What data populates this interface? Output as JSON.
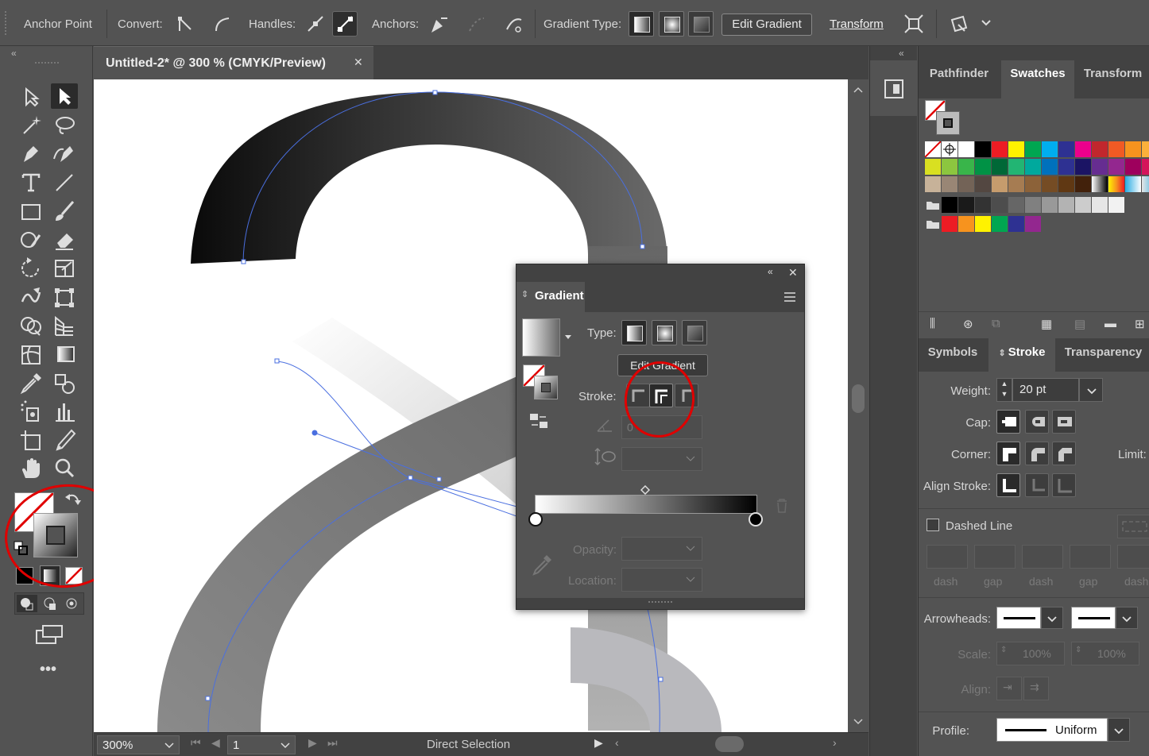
{
  "control_bar": {
    "anchor_point_label": "Anchor Point",
    "convert_label": "Convert:",
    "handles_label": "Handles:",
    "anchors_label": "Anchors:",
    "gradient_type_label": "Gradient Type:",
    "edit_gradient_label": "Edit Gradient",
    "transform_label": "Transform"
  },
  "document": {
    "tab_title": "Untitled-2* @ 300 % (CMYK/Preview)",
    "close_glyph": "✕"
  },
  "status_bar": {
    "zoom": "300%",
    "artboard_number": "1",
    "current_tool": "Direct Selection"
  },
  "gradient_panel": {
    "title": "Gradient",
    "type_label": "Type:",
    "edit_gradient_tooltip": "Edit Gradient",
    "stroke_label": "Stroke:",
    "angle_value": "0",
    "opacity_label": "Opacity:",
    "location_label": "Location:"
  },
  "right_panel": {
    "top_tabs": [
      "Pathfinder",
      "Swatches",
      "Transform"
    ],
    "active_top_tab": "Swatches",
    "bottom_tabs": [
      "Symbols",
      "Stroke",
      "Transparency"
    ],
    "active_bottom_tab": "Stroke",
    "stroke": {
      "weight_label": "Weight:",
      "weight_value": "20 pt",
      "cap_label": "Cap:",
      "corner_label": "Corner:",
      "limit_label": "Limit:",
      "align_stroke_label": "Align Stroke:",
      "dashed_line_label": "Dashed Line",
      "dash_labels": [
        "dash",
        "gap",
        "dash",
        "gap",
        "dash"
      ],
      "arrowheads_label": "Arrowheads:",
      "scale_label": "Scale:",
      "scale_values": [
        "100%",
        "100%"
      ],
      "align_label": "Align:",
      "profile_label": "Profile:",
      "profile_value": "Uniform"
    },
    "swatch_rows": [
      [
        "none",
        "reg",
        "#ffffff",
        "#000000",
        "#ed1c24",
        "#fff200",
        "#00a651",
        "#00aeef",
        "#2e3192",
        "#ec008c",
        "#c1272d",
        "#f15a24",
        "#f7931e",
        "#fbb03b"
      ],
      [
        "#d9e021",
        "#8cc63f",
        "#39b54a",
        "#009245",
        "#006837",
        "#22b573",
        "#00a99d",
        "#0071bc",
        "#2e3192",
        "#1b1464",
        "#662d91",
        "#93278f",
        "#9e005d",
        "#d4145a"
      ],
      [
        "#c7b299",
        "#998675",
        "#736357",
        "#534741",
        "#c69c6d",
        "#a67c52",
        "#8c6239",
        "#754c24",
        "#603813",
        "#42210b",
        "grad-gray",
        "grad-orange",
        "grad-blue",
        "grad-cyan"
      ],
      [
        "folder",
        "#000000",
        "#1a1a1a",
        "#333333",
        "#4d4d4d",
        "#666666",
        "#808080",
        "#999999",
        "#b3b3b3",
        "#cccccc",
        "#e6e6e6",
        "#f2f2f2"
      ],
      [
        "folder",
        "#ed1c24",
        "#f7931e",
        "#fff200",
        "#00a651",
        "#2e3192",
        "#93278f"
      ]
    ]
  }
}
